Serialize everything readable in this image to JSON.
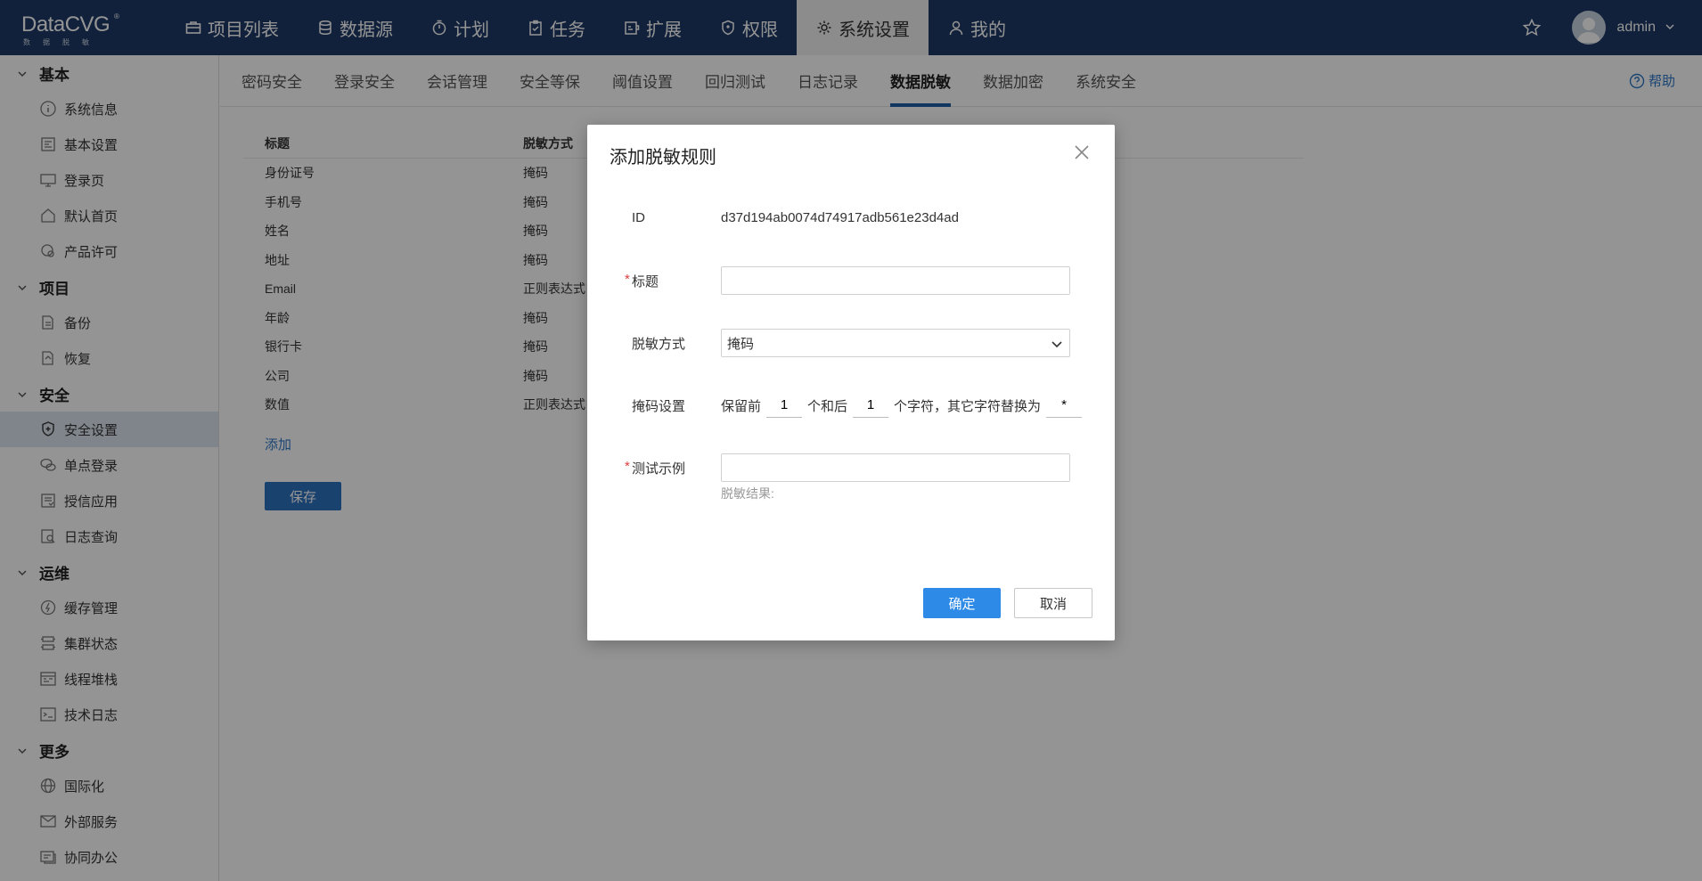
{
  "app": {
    "logo_text": "DataCVG",
    "logo_reg": "®",
    "logo_subtitle": "数据脱敏"
  },
  "topnav": {
    "items": [
      {
        "label": "项目列表",
        "icon": "briefcase-icon"
      },
      {
        "label": "数据源",
        "icon": "database-icon"
      },
      {
        "label": "计划",
        "icon": "timer-icon"
      },
      {
        "label": "任务",
        "icon": "clipboard-check-icon"
      },
      {
        "label": "扩展",
        "icon": "extension-icon"
      },
      {
        "label": "权限",
        "icon": "shield-icon"
      },
      {
        "label": "系统设置",
        "icon": "gear-icon",
        "active": true
      },
      {
        "label": "我的",
        "icon": "user-icon"
      }
    ],
    "username": "admin"
  },
  "sidebar": {
    "groups": [
      {
        "title": "基本",
        "items": [
          "系统信息",
          "基本设置",
          "登录页",
          "默认首页",
          "产品许可"
        ]
      },
      {
        "title": "项目",
        "items": [
          "备份",
          "恢复"
        ]
      },
      {
        "title": "安全",
        "items": [
          "安全设置",
          "单点登录",
          "授信应用",
          "日志查询"
        ]
      },
      {
        "title": "运维",
        "items": [
          "缓存管理",
          "集群状态",
          "线程堆栈",
          "技术日志"
        ]
      },
      {
        "title": "更多",
        "items": [
          "国际化",
          "外部服务",
          "协同办公"
        ]
      }
    ],
    "active_item": "安全设置"
  },
  "tabs": {
    "items": [
      "密码安全",
      "登录安全",
      "会话管理",
      "安全等保",
      "阈值设置",
      "回归测试",
      "日志记录",
      "数据脱敏",
      "数据加密",
      "系统安全"
    ],
    "active": "数据脱敏",
    "help": "帮助"
  },
  "table": {
    "headers": [
      "标题",
      "脱敏方式"
    ],
    "rows": [
      [
        "身份证号",
        "掩码"
      ],
      [
        "手机号",
        "掩码"
      ],
      [
        "姓名",
        "掩码"
      ],
      [
        "地址",
        "掩码"
      ],
      [
        "Email",
        "正则表达式"
      ],
      [
        "年龄",
        "掩码"
      ],
      [
        "银行卡",
        "掩码"
      ],
      [
        "公司",
        "掩码"
      ],
      [
        "数值",
        "正则表达式"
      ]
    ],
    "add_label": "添加",
    "save_label": "保存"
  },
  "modal": {
    "title": "添加脱敏规则",
    "id_label": "ID",
    "id_value": "d37d194ab0074d74917adb561e23d4ad",
    "title_label": "标题",
    "title_value": "",
    "method_label": "脱敏方式",
    "method_value": "掩码",
    "mask_label": "掩码设置",
    "mask_prefix": "保留前",
    "mask_first": "1",
    "mask_middle": "个和后",
    "mask_last": "1",
    "mask_suffix": "个字符，其它字符替换为",
    "mask_char": "*",
    "test_label": "测试示例",
    "test_value": "",
    "result_label": "脱敏结果:",
    "ok_label": "确定",
    "cancel_label": "取消",
    "required_mark": "*"
  }
}
